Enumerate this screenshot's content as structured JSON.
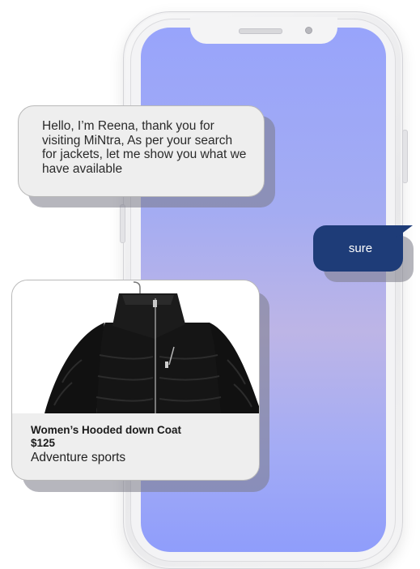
{
  "chat": {
    "bot_message": "Hello, I’m Reena, thank you for visiting MiNtra, As per your search for jackets, let me show you what we have available",
    "user_message": "sure"
  },
  "product": {
    "name": "Women’s Hooded down Coat",
    "price": "$125",
    "category": "Adventure sports",
    "image_icon": "black-puffer-jacket"
  },
  "colors": {
    "screen_gradient_top": "#98a4fb",
    "screen_gradient_mid": "#bdb5e6",
    "user_bubble": "#1e3c78",
    "bubble_bg": "#eeeeee",
    "jacket": "#151515"
  }
}
